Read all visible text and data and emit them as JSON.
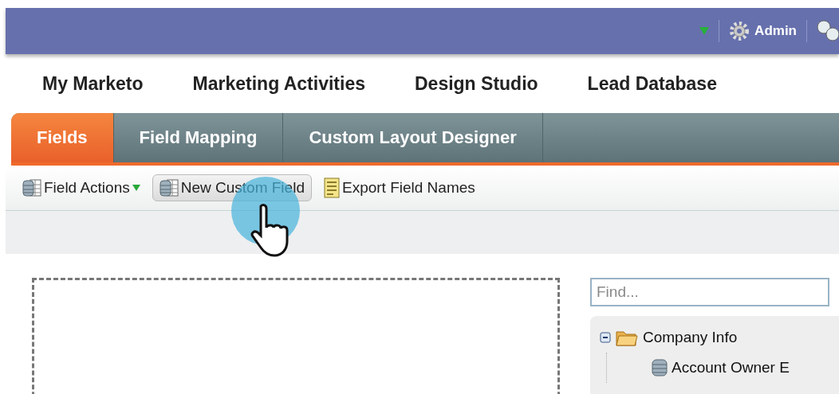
{
  "header": {
    "user": "Admin"
  },
  "nav": [
    {
      "label": "My Marketo"
    },
    {
      "label": "Marketing Activities"
    },
    {
      "label": "Design Studio"
    },
    {
      "label": "Lead Database"
    }
  ],
  "tabs": [
    {
      "label": "Fields",
      "selected": true
    },
    {
      "label": "Field Mapping",
      "selected": false
    },
    {
      "label": "Custom Layout Designer",
      "selected": false
    }
  ],
  "toolbar": [
    {
      "kind": "menu",
      "label": "Field Actions"
    },
    {
      "kind": "button",
      "label": "New Custom Field",
      "hovered": true
    },
    {
      "kind": "export",
      "label": "Export Field Names"
    }
  ],
  "search": {
    "placeholder": "Find..."
  },
  "tree": [
    {
      "label": "Company Info",
      "expanded": true,
      "children": [
        {
          "label": "Account Owner E"
        }
      ]
    }
  ]
}
